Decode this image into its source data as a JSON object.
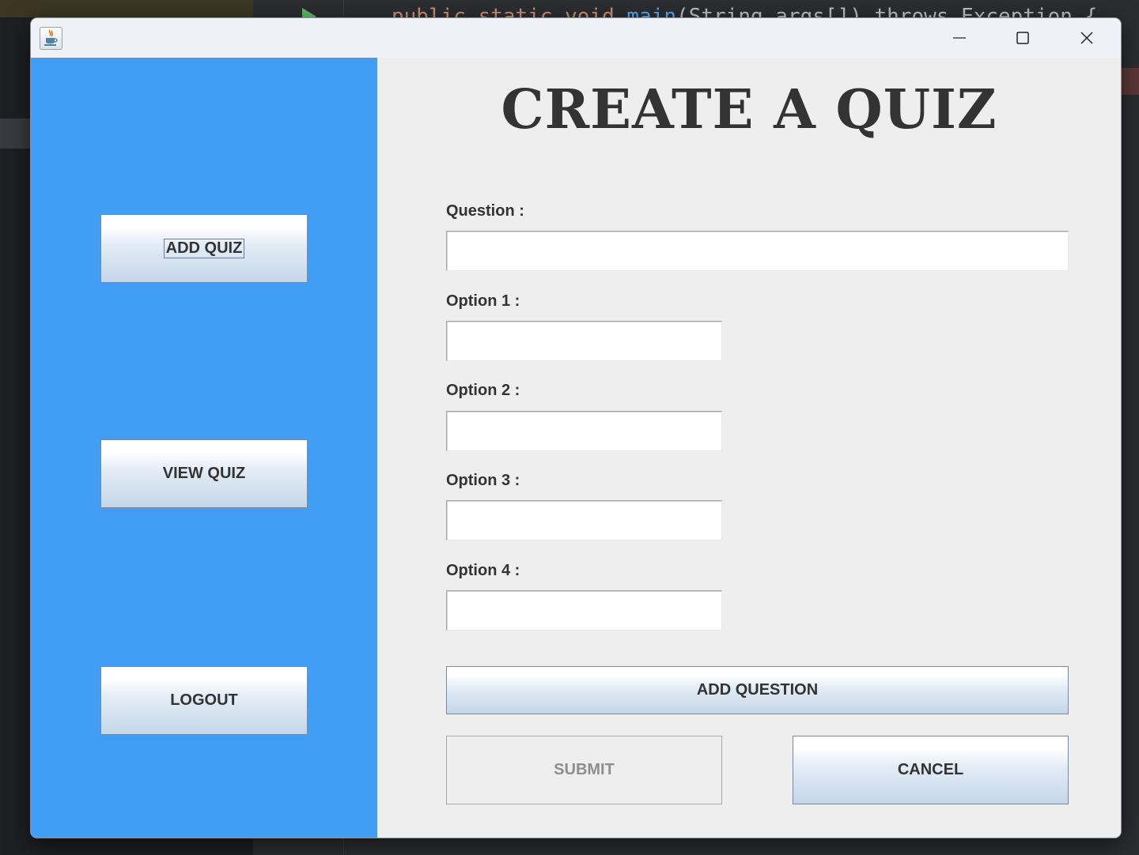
{
  "background_ide": {
    "code_line_keywords": "public static void ",
    "code_line_method": "main",
    "code_line_rest": "(String args[]) throws Exception {"
  },
  "window": {
    "app_icon": "java-cup-icon",
    "controls": {
      "minimize_icon": "minimize-icon",
      "maximize_icon": "maximize-icon",
      "close_icon": "close-icon"
    }
  },
  "sidebar": {
    "color": "#429df4",
    "buttons": {
      "add_quiz": "ADD QUIZ",
      "view_quiz": "VIEW QUIZ",
      "logout": "LOGOUT"
    }
  },
  "form": {
    "title": "CREATE A QUIZ",
    "question_label": "Question :",
    "question_value": "",
    "option1_label": "Option 1 :",
    "option1_value": "",
    "option2_label": "Option 2 :",
    "option2_value": "",
    "option3_label": "Option 3 :",
    "option3_value": "",
    "option4_label": "Option 4 :",
    "option4_value": "",
    "add_question_label": "ADD QUESTION",
    "submit_label": "SUBMIT",
    "submit_enabled": false,
    "cancel_label": "CANCEL"
  }
}
